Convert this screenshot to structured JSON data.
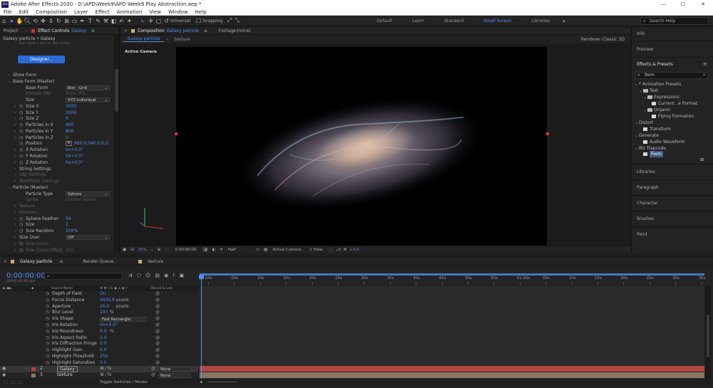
{
  "window": {
    "title": "Adobe After Effects 2020 - D:\\APD\\Week9\\APD Week9 Play Abstraction.aep *",
    "app_badge": "Ae",
    "controls": [
      "—",
      "☐",
      "✕"
    ]
  },
  "menu": [
    "File",
    "Edit",
    "Composition",
    "Layer",
    "Effect",
    "Animation",
    "View",
    "Window",
    "Help"
  ],
  "toolbar": {
    "universal_label": "Universal",
    "snapping_label": "Snapping",
    "workspaces": [
      "Default",
      "Learn",
      "Standard",
      "Small Screen",
      "Libraries"
    ],
    "active_workspace": "Small Screen",
    "search_placeholder": "Search Help"
  },
  "left_panel": {
    "tabs": {
      "project": "Project",
      "effect_controls": "Effect Controls",
      "effect_target": "Galaxy"
    },
    "breadcrumb": "Galaxy particle • Galaxy",
    "clipped_text": "(but uses 1 unit of key units)",
    "designer_button": "Designer...",
    "rows": [
      {
        "label": "Show Form",
        "indent": 1,
        "twirl": "›"
      },
      {
        "label": "Base Form (Master)",
        "indent": 1,
        "twirl": "⌄"
      },
      {
        "label": "Base Form",
        "indent": 3,
        "dropdown": "Box - Grid"
      },
      {
        "label": "Choose OBJ",
        "indent": 3,
        "dim": true,
        "value": "None (Mo...",
        "value_dim": true
      },
      {
        "label": "Size",
        "indent": 3,
        "dropdown": "XYZ Individual"
      },
      {
        "label": "Size X",
        "indent": 2,
        "twirl": "›",
        "stopwatch": true,
        "value": "3000"
      },
      {
        "label": "Size Y",
        "indent": 2,
        "twirl": "›",
        "stopwatch": true,
        "value": "3000"
      },
      {
        "label": "Size Z",
        "indent": 2,
        "twirl": "›",
        "stopwatch": true,
        "value": "0"
      },
      {
        "label": "Particles in X",
        "indent": 2,
        "twirl": "›",
        "stopwatch": true,
        "value": "800"
      },
      {
        "label": "Particles in Y",
        "indent": 2,
        "twirl": "›",
        "stopwatch": true,
        "value": "800"
      },
      {
        "label": "Particles in Z",
        "indent": 2,
        "twirl": "›",
        "stopwatch": true,
        "value": "1"
      },
      {
        "label": "Position",
        "indent": 2,
        "stopwatch": true,
        "value": "960.0,540.0,0.0",
        "crosshair": true
      },
      {
        "label": "X Rotation",
        "indent": 2,
        "twirl": "›",
        "stopwatch": true,
        "value": "0x+0.0°"
      },
      {
        "label": "Y Rotation",
        "indent": 2,
        "twirl": "›",
        "stopwatch": true,
        "value": "0x+0.0°"
      },
      {
        "label": "Z Rotation",
        "indent": 2,
        "twirl": "›",
        "stopwatch": true,
        "value": "0x+0.0°"
      },
      {
        "label": "String Settings",
        "indent": 2,
        "twirl": "›"
      },
      {
        "label": "OBJ Settings",
        "indent": 2,
        "twirl": "›",
        "dim": true
      },
      {
        "label": "Text/Mask Settings",
        "indent": 2,
        "twirl": "›",
        "dim": true
      },
      {
        "label": "Particle (Master)",
        "indent": 1,
        "twirl": "⌄"
      },
      {
        "label": "Particle Type",
        "indent": 3,
        "dropdown": "Sphere"
      },
      {
        "label": "Sprite",
        "indent": 3,
        "dim": true,
        "value": "Choose Sprite...",
        "value_dim": true
      },
      {
        "label": "Texture",
        "indent": 2,
        "twirl": "›",
        "dim": true
      },
      {
        "label": "Rotation",
        "indent": 2,
        "twirl": "›",
        "dim": true
      },
      {
        "label": "Sphere Feather",
        "indent": 2,
        "twirl": "›",
        "stopwatch": true,
        "value": "50"
      },
      {
        "label": "Size",
        "indent": 2,
        "twirl": "›",
        "stopwatch": true,
        "value": "2"
      },
      {
        "label": "Size Random",
        "indent": 2,
        "twirl": "›",
        "stopwatch": true,
        "value": "100%"
      },
      {
        "label": "Size Over",
        "indent": 2,
        "twirl": "›",
        "dropdown": "Off"
      },
      {
        "label": "Size Curve",
        "indent": 2,
        "twirl": "›",
        "dim": true,
        "stopwatch": true
      },
      {
        "label": "Size Curve Offset",
        "indent": 2,
        "twirl": "›",
        "dim": true,
        "stopwatch": true,
        "value": "100",
        "value_dim": true
      }
    ]
  },
  "comp_panel": {
    "tab_label": "Composition",
    "comp_name": "Galaxy particle",
    "footage_tab": "Footage",
    "footage_value": "(none)",
    "subtabs": [
      "Galaxy particle",
      "texture"
    ],
    "renderer_label": "Renderer:",
    "renderer_value": "Classic 3D",
    "camera_label": "Active Camera",
    "footer": {
      "zoom": "25%",
      "timecode": "0:00:00:00",
      "resolution": "Half",
      "view": "Active Camera",
      "views_count": "1 View",
      "exposure": "+0.0"
    }
  },
  "right_panel": {
    "sections_top": [
      "Info",
      "Preview"
    ],
    "effects_title": "Effects & Presets",
    "search_value": "form",
    "tree": [
      {
        "label": "* Animation Presets",
        "indent": 0,
        "twirl": "⌄"
      },
      {
        "label": "Text",
        "indent": 1,
        "twirl": "⌄",
        "folder": true
      },
      {
        "label": "Expressions",
        "indent": 2,
        "twirl": "⌄",
        "folder": true
      },
      {
        "label": "Current...e Format",
        "indent": 4,
        "preset": true
      },
      {
        "label": "Organic",
        "indent": 2,
        "twirl": "⌄",
        "folder": true
      },
      {
        "label": "Flying Formation",
        "indent": 4,
        "preset": true
      },
      {
        "label": "Distort",
        "indent": 0,
        "twirl": "⌄"
      },
      {
        "label": "Transform",
        "indent": 2,
        "preset": true
      },
      {
        "label": "Generate",
        "indent": 0,
        "twirl": "⌄"
      },
      {
        "label": "Audio Waveform",
        "indent": 2,
        "preset": true
      },
      {
        "label": "RG Trapcode",
        "indent": 0,
        "twirl": "⌄"
      },
      {
        "label": "Form",
        "indent": 2,
        "preset": true,
        "selected": true
      }
    ],
    "sections_bottom": [
      "Libraries",
      "Paragraph",
      "Character",
      "Brushes",
      "Paint"
    ]
  },
  "timeline": {
    "tabs": [
      "Galaxy particle",
      "Render Queue",
      "texture"
    ],
    "timecode": "0:00:00:00",
    "frame_info": "00000 (25.00 fps)",
    "col_source": "Source Name",
    "col_parent": "Parent & Link",
    "ruler": [
      "00s",
      "05s",
      "10s",
      "15s",
      "20s",
      "25s",
      "30s",
      "35s",
      "40s",
      "45s",
      "50s",
      "55s",
      "01:00s",
      "05s",
      "10s",
      "15s",
      "20s",
      "25s",
      "30s",
      "35s"
    ],
    "properties": [
      {
        "label": "Depth of Field",
        "value": "On"
      },
      {
        "label": "Focus Distance",
        "value": "4930.8",
        "unit": "pixels"
      },
      {
        "label": "Aperture",
        "value": "20.0",
        "unit": "pixels"
      },
      {
        "label": "Blur Level",
        "value": "193",
        "unit": "%"
      },
      {
        "label": "Iris Shape",
        "dropdown": "Fast Rectangle"
      },
      {
        "label": "Iris Rotation",
        "value": "0x+0.0°"
      },
      {
        "label": "Iris Roundness",
        "value": "0.0",
        "unit": "%"
      },
      {
        "label": "Iris Aspect Ratio",
        "value": "1.0"
      },
      {
        "label": "Iris Diffraction Fringe",
        "value": "0.0"
      },
      {
        "label": "Highlight Gain",
        "value": "0.0"
      },
      {
        "label": "Highlight Threshold",
        "value": "255"
      },
      {
        "label": "Highlight Saturation",
        "value": "0.0"
      }
    ],
    "layers": [
      {
        "num": "2",
        "name": "Galaxy",
        "parent": "None",
        "color": "#c23b3b",
        "selected": true
      },
      {
        "num": "3",
        "name": "texture",
        "parent": "None",
        "color": "#8c7a64",
        "selected": false
      }
    ],
    "footer_label": "Toggle Switches / Modes"
  },
  "colors": {
    "accent": "#4d8ef0",
    "bg": "#232323",
    "track_red": "#b44545",
    "track_tan": "#8a7661"
  }
}
